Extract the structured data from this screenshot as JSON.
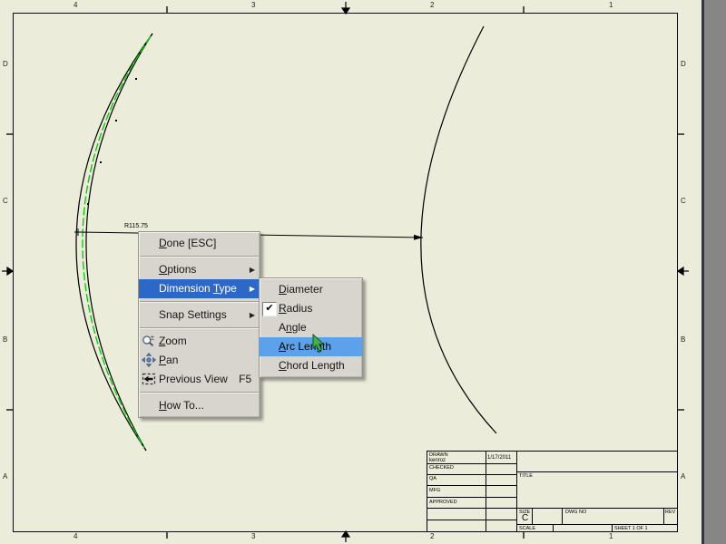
{
  "app": {
    "sheet_color": "#ECECDB",
    "outside_color": "#868686",
    "selection_green": "#00D400",
    "menu_highlight_blue": "#2c68c8",
    "submenu_highlight_blue": "#5ca2ea"
  },
  "drawing": {
    "dimension_label": "R115.75"
  },
  "border_zones": {
    "top_labels": [
      "4",
      "3",
      "2",
      "1"
    ],
    "bottom_labels": [
      "4",
      "3",
      "2",
      "1"
    ],
    "left_labels": [
      "D",
      "C",
      "B",
      "A"
    ],
    "right_labels": [
      "D",
      "C",
      "B",
      "A"
    ]
  },
  "context_menu": {
    "items": [
      {
        "pre": "",
        "key": "D",
        "post": "one [ESC]"
      },
      {
        "pre": "",
        "key": "O",
        "post": "ptions"
      },
      {
        "pre": "Dimension ",
        "key": "T",
        "post": "ype"
      },
      {
        "pre": "Snap Settings",
        "key": "",
        "post": ""
      },
      {
        "pre": "",
        "key": "Z",
        "post": "oom"
      },
      {
        "pre": "",
        "key": "P",
        "post": "an"
      },
      {
        "pre": "Previous View",
        "key": "",
        "post": "",
        "shortcut": "F5"
      },
      {
        "pre": "",
        "key": "H",
        "post": "ow To..."
      }
    ],
    "submenu_items": [
      {
        "pre": "",
        "key": "D",
        "post": "iameter"
      },
      {
        "pre": "",
        "key": "R",
        "post": "adius",
        "checked": true
      },
      {
        "pre": "A",
        "key": "n",
        "post": "gle"
      },
      {
        "pre": "",
        "key": "A",
        "post": "rc Length"
      },
      {
        "pre": "",
        "key": "C",
        "post": "hord Length"
      }
    ],
    "glyphs": {
      "submenu_arrow": "▶",
      "check": "✔"
    }
  },
  "title_block": {
    "drawn_label": "DRAWN",
    "drawn_value": "kenroz",
    "drawn_date": "1/17/2011",
    "checked_label": "CHECKED",
    "qa_label": "QA",
    "mfg_label": "MFG",
    "approved_label": "APPROVED",
    "title_label": "TITLE",
    "size_label": "SIZE",
    "size_value": "C",
    "dwg_no_label": "DWG NO",
    "rev_label": "REV",
    "scale_label": "SCALE",
    "sheet_label": "SHEET 1 OF 1"
  }
}
